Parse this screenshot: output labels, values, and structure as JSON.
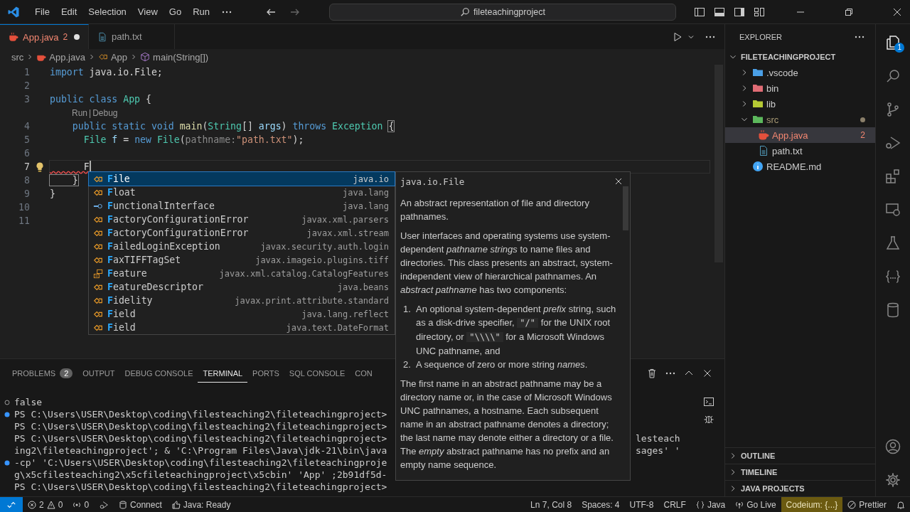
{
  "title_bar": {
    "menu": [
      "File",
      "Edit",
      "Selection",
      "View",
      "Go",
      "Run"
    ],
    "search": "fileteachingproject"
  },
  "editor_tabs": [
    {
      "label": "App.java",
      "kind": "java",
      "problems": "2",
      "modified": true,
      "selected": true
    },
    {
      "label": "path.txt",
      "kind": "text",
      "modified": false,
      "selected": false
    }
  ],
  "breadcrumb": [
    "src",
    "App.java",
    "App",
    "main(String[])"
  ],
  "code": [
    {
      "kind": "code",
      "number": "1",
      "current": false,
      "lightbulb": false,
      "tokens": [
        {
          "kind": "keyword",
          "text": "import"
        },
        {
          "kind": "plain",
          "text": " java.io.File;"
        }
      ]
    },
    {
      "kind": "code",
      "number": "2",
      "current": false,
      "lightbulb": false
    },
    {
      "kind": "code",
      "number": "3",
      "current": false,
      "lightbulb": false,
      "tokens": [
        {
          "kind": "keyword",
          "text": "public class "
        },
        {
          "kind": "type",
          "text": "App"
        },
        {
          "kind": "plain",
          "text": " {"
        }
      ]
    },
    {
      "kind": "codelens",
      "actions": [
        "Run",
        "Debug"
      ],
      "separator": "|"
    },
    {
      "kind": "code",
      "number": "4",
      "current": false,
      "lightbulb": false,
      "tokens": [
        {
          "kind": "keyword",
          "text": "    public static void "
        },
        {
          "kind": "func",
          "text": "main"
        },
        {
          "kind": "plain",
          "text": "("
        },
        {
          "kind": "type",
          "text": "String"
        },
        {
          "kind": "plain",
          "text": "[] "
        },
        {
          "kind": "var",
          "text": "args"
        },
        {
          "kind": "plain",
          "text": ") "
        },
        {
          "kind": "keyword",
          "text": "throws "
        },
        {
          "kind": "type",
          "text": "Exception "
        },
        {
          "kind": "bracket-match",
          "text": "{"
        }
      ]
    },
    {
      "kind": "code",
      "number": "5",
      "current": false,
      "lightbulb": false,
      "tokens": [
        {
          "kind": "type",
          "text": "      File "
        },
        {
          "kind": "var",
          "text": "f"
        },
        {
          "kind": "plain",
          "text": " = "
        },
        {
          "kind": "keyword",
          "text": "new "
        },
        {
          "kind": "type",
          "text": "File"
        },
        {
          "kind": "plain",
          "text": "("
        },
        {
          "kind": "hint",
          "text": "pathname:"
        },
        {
          "kind": "string",
          "text": "\"path.txt\""
        },
        {
          "kind": "plain",
          "text": ");"
        }
      ]
    },
    {
      "kind": "code",
      "number": "6",
      "current": false,
      "lightbulb": false
    },
    {
      "kind": "code",
      "number": "7",
      "current": true,
      "lightbulb": true,
      "tokens": [
        {
          "kind": "error",
          "text": "      F"
        }
      ]
    },
    {
      "kind": "code",
      "number": "8",
      "current": false,
      "lightbulb": false,
      "tokens": [
        {
          "kind": "bracket-match",
          "text": "    }"
        }
      ]
    },
    {
      "kind": "code",
      "number": "9",
      "current": false,
      "lightbulb": false,
      "tokens": [
        {
          "kind": "plain",
          "text": "}"
        }
      ]
    },
    {
      "kind": "code",
      "number": "10",
      "current": false,
      "lightbulb": false
    },
    {
      "kind": "code",
      "number": "11",
      "current": false,
      "lightbulb": false
    }
  ],
  "suggestions": [
    {
      "label": "File",
      "detail": "java.io",
      "kind": "class",
      "selected": true
    },
    {
      "label": "Float",
      "detail": "java.lang",
      "kind": "class",
      "selected": false
    },
    {
      "label": "FunctionalInterface",
      "detail": "java.lang",
      "kind": "interface",
      "selected": false
    },
    {
      "label": "FactoryConfigurationError",
      "detail": "javax.xml.parsers",
      "kind": "class",
      "selected": false
    },
    {
      "label": "FactoryConfigurationError",
      "detail": "javax.xml.stream",
      "kind": "class",
      "selected": false
    },
    {
      "label": "FailedLoginException",
      "detail": "javax.security.auth.login",
      "kind": "class",
      "selected": false
    },
    {
      "label": "FaxTIFFTagSet",
      "detail": "javax.imageio.plugins.tiff",
      "kind": "class",
      "selected": false
    },
    {
      "label": "Feature",
      "detail": "javax.xml.catalog.CatalogFeatures",
      "kind": "enum",
      "selected": false
    },
    {
      "label": "FeatureDescriptor",
      "detail": "java.beans",
      "kind": "class",
      "selected": false
    },
    {
      "label": "Fidelity",
      "detail": "javax.print.attribute.standard",
      "kind": "class",
      "selected": false
    },
    {
      "label": "Field",
      "detail": "java.lang.reflect",
      "kind": "class",
      "selected": false
    },
    {
      "label": "Field",
      "detail": "java.text.DateFormat",
      "kind": "class",
      "selected": false
    }
  ],
  "docs": {
    "title": "java.io.File",
    "paragraphs_before": [
      "An abstract representation of file and directory pathnames.",
      "User interfaces and operating systems use system-dependent *pathname strings* to name files and directories. This class presents an abstract, system-independent view of hierarchical pathnames. An *abstract pathname* has two components:"
    ],
    "list": [
      {
        "number": "1.",
        "segments": [
          {
            "kind": "text",
            "text": "An optional system-dependent *prefix* string, such as a disk-drive specifier, "
          },
          {
            "kind": "code",
            "text": "\"/\""
          },
          {
            "kind": "text",
            "text": " for the UNIX root directory, or "
          },
          {
            "kind": "code",
            "text": "\"\\\\\\\\\""
          },
          {
            "kind": "text",
            "text": " for a Microsoft Windows UNC pathname, and"
          }
        ]
      },
      {
        "number": "2.",
        "segments": [
          {
            "kind": "text",
            "text": "A sequence of zero or more string *names*."
          }
        ]
      }
    ],
    "paragraphs_after": [
      "The first name in an abstract pathname may be a directory name or, in the case of Microsoft Windows UNC pathnames, a hostname. Each subsequent name in an abstract pathname denotes a directory; the last name may denote either a directory or a file. The *empty* abstract pathname has no prefix and an empty name sequence."
    ]
  },
  "panel_tabs": [
    {
      "label": "PROBLEMS",
      "count": "2",
      "selected": false
    },
    {
      "label": "OUTPUT",
      "selected": false
    },
    {
      "label": "DEBUG CONSOLE",
      "selected": false
    },
    {
      "label": "TERMINAL",
      "selected": true
    },
    {
      "label": "PORTS",
      "selected": false
    },
    {
      "label": "SQL CONSOLE",
      "selected": false
    },
    {
      "label": "CON",
      "selected": false
    }
  ],
  "terminal": [
    {
      "kind": "hollow",
      "text": "false"
    },
    {
      "kind": "filled",
      "text": "PS C:\\Users\\USER\\Desktop\\coding\\filesteaching2\\fileteachingproject>"
    },
    {
      "kind": "plain",
      "text": "PS C:\\Users\\USER\\Desktop\\coding\\filesteaching2\\fileteachingproject>"
    },
    {
      "kind": "plain",
      "text": "PS C:\\Users\\USER\\Desktop\\coding\\filesteaching2\\fileteachingproject>",
      "tail": "lesteach"
    },
    {
      "kind": "plain",
      "text": "ing2\\fileteachingproject'; & 'C:\\Program Files\\Java\\jdk-21\\bin\\java",
      "tail": "sages' '"
    },
    {
      "kind": "filled",
      "text": "-cp' 'C:\\Users\\USER\\Desktop\\coding\\filesteaching2\\fileteachingproje"
    },
    {
      "kind": "plain",
      "text": "g\\x5cfilesteaching2\\x5cfileteachingproject\\x5cbin' 'App' ;2b91df5d-"
    },
    {
      "kind": "plain",
      "text": "PS C:\\Users\\USER\\Desktop\\coding\\filesteaching2\\fileteachingproject>"
    }
  ],
  "explorer": {
    "title": "EXPLORER",
    "project": "FILETEACHINGPROJECT",
    "project_expanded": true,
    "tree": [
      {
        "label": ".vscode",
        "kind": "folder",
        "color": "#4a9fe6",
        "expanded": false,
        "selected": false,
        "changed": false
      },
      {
        "label": "bin",
        "kind": "folder",
        "color": "#e06c75",
        "expanded": false,
        "selected": false,
        "changed": false
      },
      {
        "label": "lib",
        "kind": "folder",
        "color": "#b5c934",
        "expanded": false,
        "selected": false,
        "changed": false
      },
      {
        "label": "src",
        "kind": "folder",
        "color": "#5cb85c",
        "expanded": true,
        "selected": false,
        "changed": true,
        "children": [
          {
            "label": "App.java",
            "kind": "java",
            "problems": "2",
            "selected": true,
            "changed": false
          },
          {
            "label": "path.txt",
            "kind": "text",
            "selected": false,
            "changed": false
          }
        ]
      },
      {
        "label": "README.md",
        "kind": "info",
        "selected": false,
        "changed": false
      }
    ],
    "sections": [
      {
        "label": "OUTLINE",
        "expanded": false
      },
      {
        "label": "TIMELINE",
        "expanded": false
      },
      {
        "label": "JAVA PROJECTS",
        "expanded": false
      }
    ]
  },
  "activity_bar": {
    "badge": "1"
  },
  "status_bar": {
    "errors": "2",
    "warnings": "0",
    "ports": "0",
    "connect": "Connect",
    "java_status": "Java: Ready",
    "position": "Ln 7, Col 8",
    "indentation": "Spaces: 4",
    "encoding": "UTF-8",
    "eol": "CRLF",
    "language": "Java",
    "go_live": "Go Live",
    "codeium": "Codeium: {...}",
    "prettier": "Prettier"
  }
}
